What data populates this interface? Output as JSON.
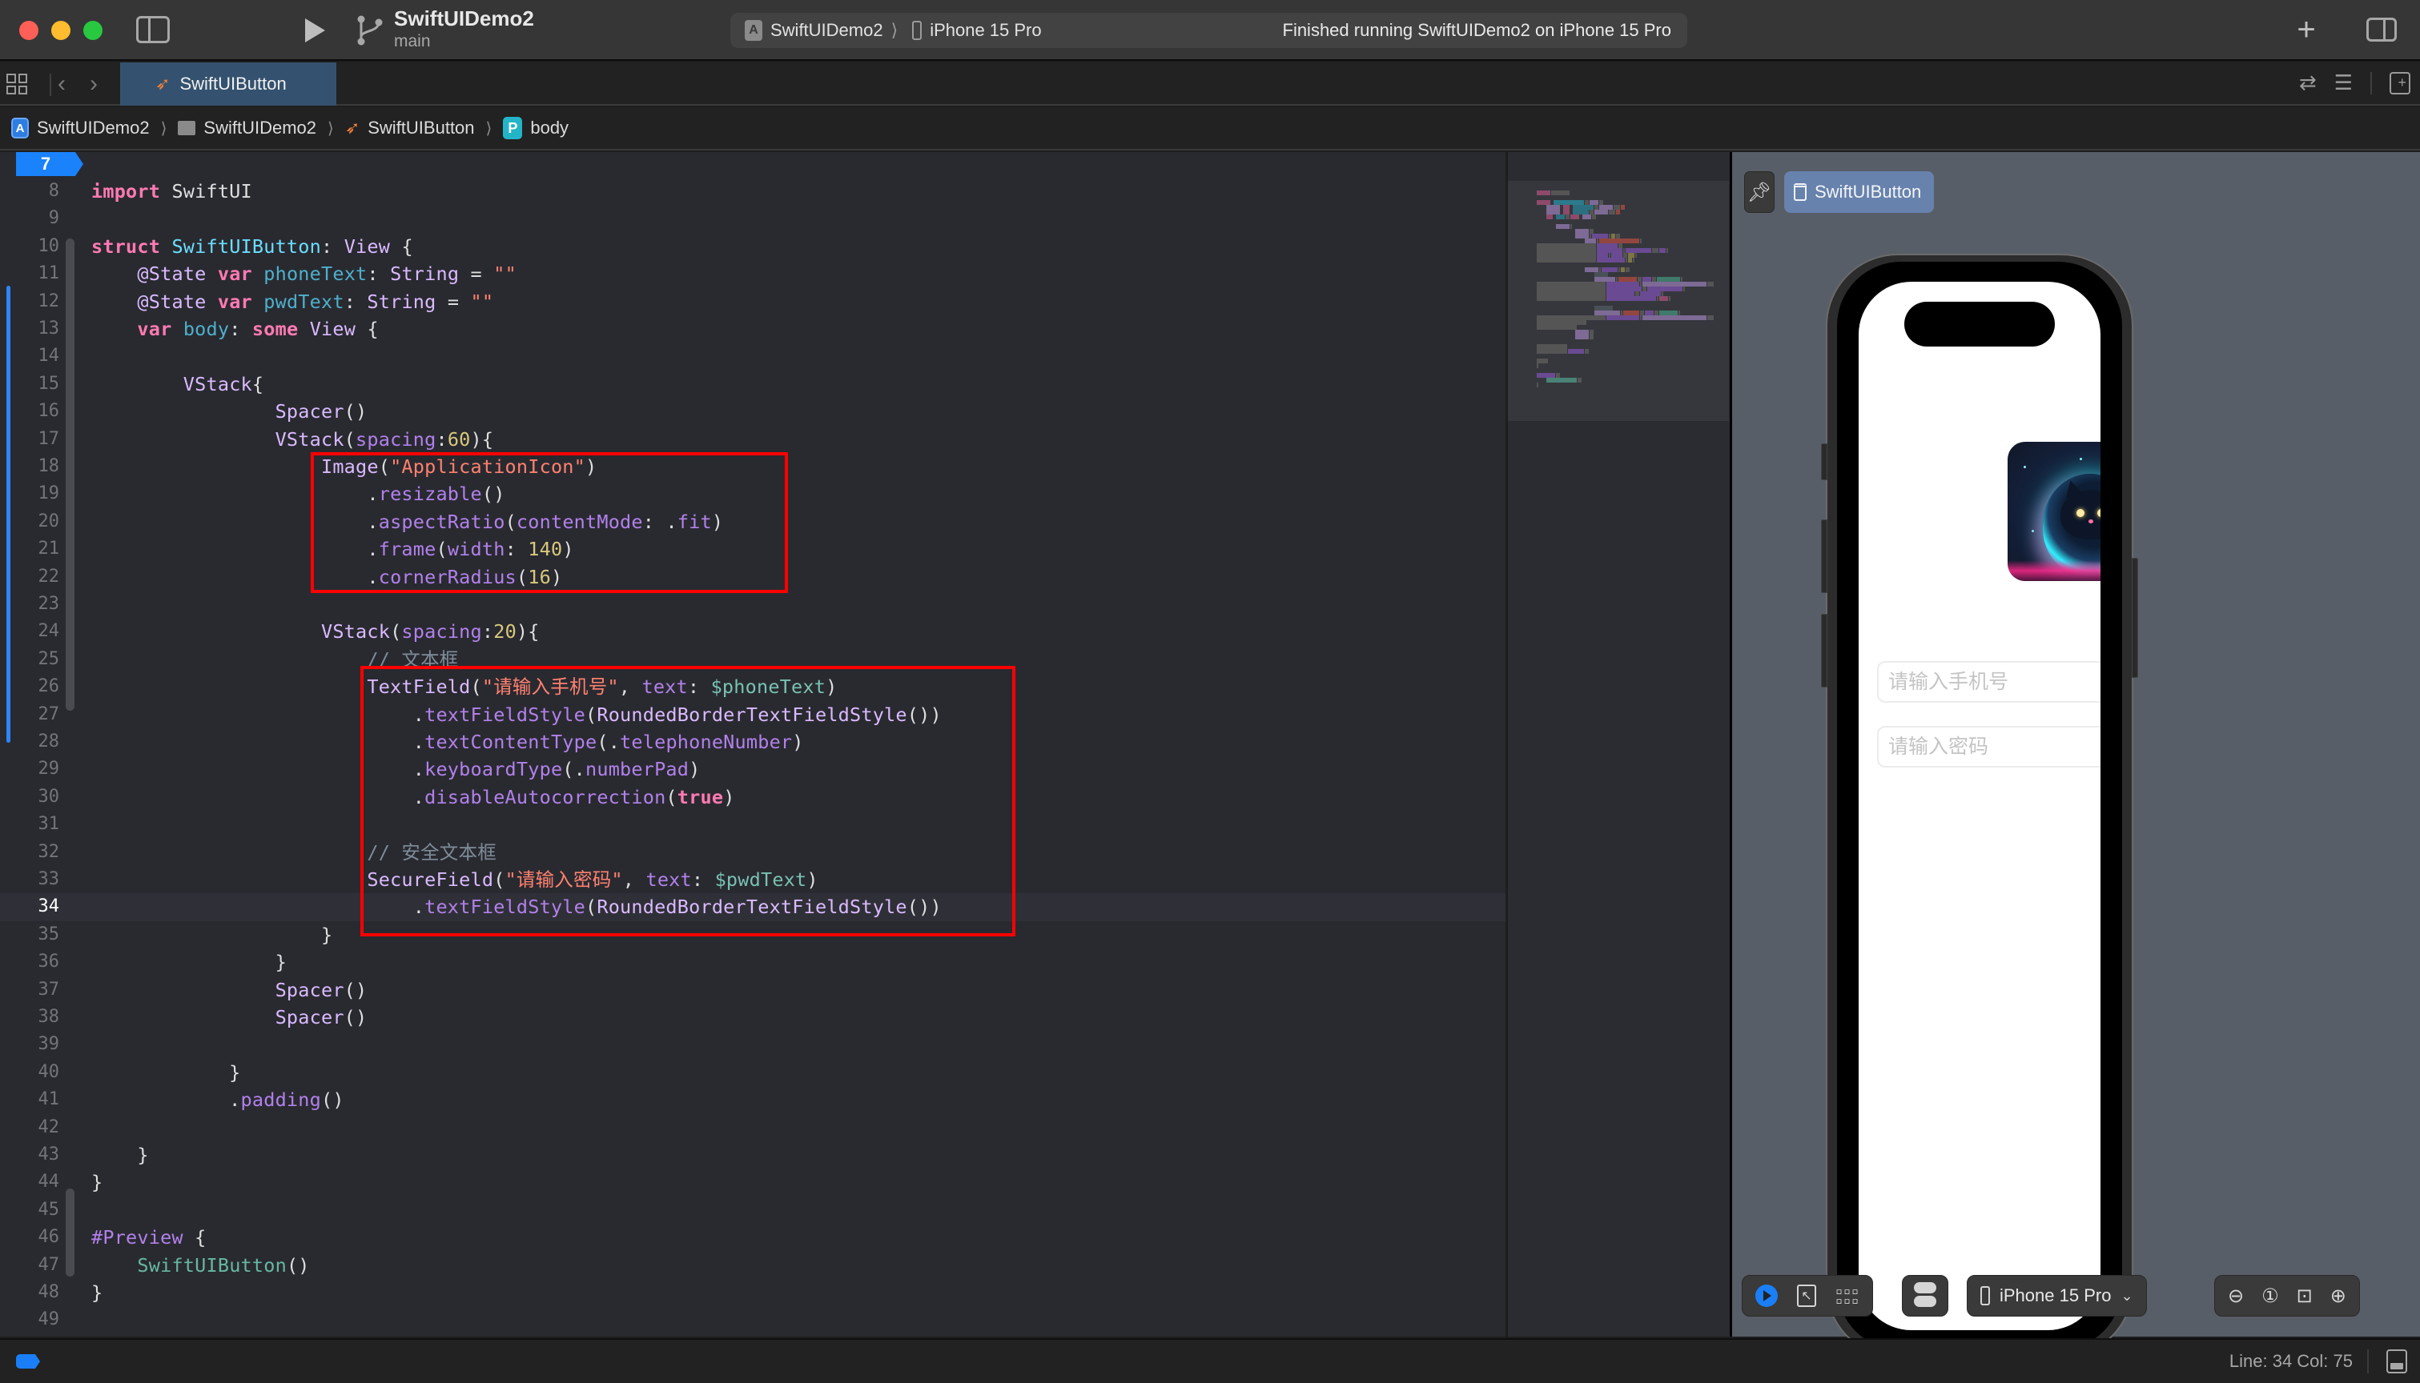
{
  "window": {
    "project_name": "SwiftUIDemo2",
    "branch": "main",
    "activity": {
      "scheme": "SwiftUIDemo2",
      "destination": "iPhone 15 Pro",
      "status": "Finished running SwiftUIDemo2 on iPhone 15 Pro"
    },
    "icons": {
      "close": "close-window",
      "minimize": "minimize-window",
      "zoom": "zoom-window",
      "navigator": "sidebar-left-icon",
      "run": "play-icon",
      "branch": "branch-icon",
      "add": "plus-icon",
      "inspector": "sidebar-right-icon"
    }
  },
  "tabs": [
    {
      "label": "SwiftUIButton",
      "icon": "swift-icon",
      "active": true
    }
  ],
  "tab_bar_right": [
    "swap-icon",
    "minimap-toggle-icon",
    "add-editor-icon"
  ],
  "breadcrumb": [
    {
      "label": "SwiftUIDemo2",
      "icon": "app-project-icon"
    },
    {
      "label": "SwiftUIDemo2",
      "icon": "folder-icon"
    },
    {
      "label": "SwiftUIButton",
      "icon": "swift-icon"
    },
    {
      "label": "body",
      "icon": "property-icon",
      "icon_letter": "P"
    }
  ],
  "editor": {
    "first_line_marker": "7",
    "current_line": 34,
    "lines": [
      {
        "n": "8",
        "tokens": [
          [
            "kw",
            "import"
          ],
          [
            "pl",
            " SwiftUI"
          ]
        ]
      },
      {
        "n": "9",
        "tokens": []
      },
      {
        "n": "10",
        "tokens": [
          [
            "kw",
            "struct"
          ],
          [
            "pl",
            " "
          ],
          [
            "pr",
            "SwiftUIButton"
          ],
          [
            "pl",
            ": "
          ],
          [
            "ty",
            "View"
          ],
          [
            "pl",
            " {"
          ]
        ]
      },
      {
        "n": "11",
        "tokens": [
          [
            "pl",
            "    "
          ],
          [
            "ty",
            "@State"
          ],
          [
            "pl",
            " "
          ],
          [
            "kw",
            "var"
          ],
          [
            "pl",
            " "
          ],
          [
            "pr2",
            "phoneText"
          ],
          [
            "pl",
            ": "
          ],
          [
            "ty",
            "String"
          ],
          [
            "pl",
            " = "
          ],
          [
            "st",
            "\"\""
          ]
        ]
      },
      {
        "n": "12",
        "tokens": [
          [
            "pl",
            "    "
          ],
          [
            "ty",
            "@State"
          ],
          [
            "pl",
            " "
          ],
          [
            "kw",
            "var"
          ],
          [
            "pl",
            " "
          ],
          [
            "pr2",
            "pwdText"
          ],
          [
            "pl",
            ": "
          ],
          [
            "ty",
            "String"
          ],
          [
            "pl",
            " = "
          ],
          [
            "st",
            "\"\""
          ]
        ]
      },
      {
        "n": "13",
        "tokens": [
          [
            "pl",
            "    "
          ],
          [
            "kw",
            "var"
          ],
          [
            "pl",
            " "
          ],
          [
            "pr2",
            "body"
          ],
          [
            "pl",
            ": "
          ],
          [
            "kw",
            "some"
          ],
          [
            "pl",
            " "
          ],
          [
            "ty",
            "View"
          ],
          [
            "pl",
            " {"
          ]
        ]
      },
      {
        "n": "14",
        "tokens": []
      },
      {
        "n": "15",
        "tokens": [
          [
            "pl",
            "        "
          ],
          [
            "ty",
            "VStack"
          ],
          [
            "pl",
            "{"
          ]
        ]
      },
      {
        "n": "16",
        "tokens": [
          [
            "pl",
            "                "
          ],
          [
            "ty",
            "Spacer"
          ],
          [
            "pl",
            "()"
          ]
        ]
      },
      {
        "n": "17",
        "tokens": [
          [
            "pl",
            "                "
          ],
          [
            "ty",
            "VStack"
          ],
          [
            "pl",
            "("
          ],
          [
            "fn",
            "spacing"
          ],
          [
            "pl",
            ":"
          ],
          [
            "nm",
            "60"
          ],
          [
            "pl",
            "){"
          ]
        ]
      },
      {
        "n": "18",
        "tokens": [
          [
            "pl",
            "                    "
          ],
          [
            "ty",
            "Image"
          ],
          [
            "pl",
            "("
          ],
          [
            "st",
            "\"ApplicationIcon\""
          ],
          [
            "pl",
            ")"
          ]
        ]
      },
      {
        "n": "19",
        "tokens": [
          [
            "pl",
            "                        ."
          ],
          [
            "fn",
            "resizable"
          ],
          [
            "pl",
            "()"
          ]
        ]
      },
      {
        "n": "20",
        "tokens": [
          [
            "pl",
            "                        ."
          ],
          [
            "fn",
            "aspectRatio"
          ],
          [
            "pl",
            "("
          ],
          [
            "fn",
            "contentMode"
          ],
          [
            "pl",
            ": ."
          ],
          [
            "fn",
            "fit"
          ],
          [
            "pl",
            ")"
          ]
        ]
      },
      {
        "n": "21",
        "tokens": [
          [
            "pl",
            "                        ."
          ],
          [
            "fn",
            "frame"
          ],
          [
            "pl",
            "("
          ],
          [
            "fn",
            "width"
          ],
          [
            "pl",
            ": "
          ],
          [
            "nm",
            "140"
          ],
          [
            "pl",
            ")"
          ]
        ]
      },
      {
        "n": "22",
        "tokens": [
          [
            "pl",
            "                        ."
          ],
          [
            "fn",
            "cornerRadius"
          ],
          [
            "pl",
            "("
          ],
          [
            "nm",
            "16"
          ],
          [
            "pl",
            ")"
          ]
        ]
      },
      {
        "n": "23",
        "tokens": []
      },
      {
        "n": "24",
        "tokens": [
          [
            "pl",
            "                    "
          ],
          [
            "ty",
            "VStack"
          ],
          [
            "pl",
            "("
          ],
          [
            "fn",
            "spacing"
          ],
          [
            "pl",
            ":"
          ],
          [
            "nm",
            "20"
          ],
          [
            "pl",
            "){"
          ]
        ]
      },
      {
        "n": "25",
        "tokens": [
          [
            "pl",
            "                        "
          ],
          [
            "cm",
            "// 文本框"
          ]
        ]
      },
      {
        "n": "26",
        "tokens": [
          [
            "pl",
            "                        "
          ],
          [
            "ty",
            "TextField"
          ],
          [
            "pl",
            "("
          ],
          [
            "st",
            "\"请输入手机号\""
          ],
          [
            "pl",
            ", "
          ],
          [
            "fn",
            "text"
          ],
          [
            "pl",
            ": "
          ],
          [
            "tx",
            "$phoneText"
          ],
          [
            "pl",
            ")"
          ]
        ]
      },
      {
        "n": "27",
        "tokens": [
          [
            "pl",
            "                            ."
          ],
          [
            "fn",
            "textFieldStyle"
          ],
          [
            "pl",
            "("
          ],
          [
            "ty",
            "RoundedBorderTextFieldStyle"
          ],
          [
            "pl",
            "())"
          ]
        ]
      },
      {
        "n": "28",
        "tokens": [
          [
            "pl",
            "                            ."
          ],
          [
            "fn",
            "textContentType"
          ],
          [
            "pl",
            "(."
          ],
          [
            "fn",
            "telephoneNumber"
          ],
          [
            "pl",
            ")"
          ]
        ]
      },
      {
        "n": "29",
        "tokens": [
          [
            "pl",
            "                            ."
          ],
          [
            "fn",
            "keyboardType"
          ],
          [
            "pl",
            "(."
          ],
          [
            "fn",
            "numberPad"
          ],
          [
            "pl",
            ")"
          ]
        ]
      },
      {
        "n": "30",
        "tokens": [
          [
            "pl",
            "                            ."
          ],
          [
            "fn",
            "disableAutocorrection"
          ],
          [
            "pl",
            "("
          ],
          [
            "kw",
            "true"
          ],
          [
            "pl",
            ")"
          ]
        ]
      },
      {
        "n": "31",
        "tokens": []
      },
      {
        "n": "32",
        "tokens": [
          [
            "pl",
            "                        "
          ],
          [
            "cm",
            "// 安全文本框"
          ]
        ]
      },
      {
        "n": "33",
        "tokens": [
          [
            "pl",
            "                        "
          ],
          [
            "ty",
            "SecureField"
          ],
          [
            "pl",
            "("
          ],
          [
            "st",
            "\"请输入密码\""
          ],
          [
            "pl",
            ", "
          ],
          [
            "fn",
            "text"
          ],
          [
            "pl",
            ": "
          ],
          [
            "tx",
            "$pwdText"
          ],
          [
            "pl",
            ")"
          ]
        ]
      },
      {
        "n": "34",
        "tokens": [
          [
            "pl",
            "                            ."
          ],
          [
            "fn",
            "textFieldStyle"
          ],
          [
            "pl",
            "("
          ],
          [
            "ty",
            "RoundedBorderTextFieldStyle"
          ],
          [
            "pl",
            "())"
          ]
        ]
      },
      {
        "n": "35",
        "tokens": [
          [
            "pl",
            "                    }"
          ]
        ]
      },
      {
        "n": "36",
        "tokens": [
          [
            "pl",
            "                }"
          ]
        ]
      },
      {
        "n": "37",
        "tokens": [
          [
            "pl",
            "                "
          ],
          [
            "ty",
            "Spacer"
          ],
          [
            "pl",
            "()"
          ]
        ]
      },
      {
        "n": "38",
        "tokens": [
          [
            "pl",
            "                "
          ],
          [
            "ty",
            "Spacer"
          ],
          [
            "pl",
            "()"
          ]
        ]
      },
      {
        "n": "39",
        "tokens": []
      },
      {
        "n": "40",
        "tokens": [
          [
            "pl",
            "            }"
          ]
        ]
      },
      {
        "n": "41",
        "tokens": [
          [
            "pl",
            "            ."
          ],
          [
            "fn",
            "padding"
          ],
          [
            "pl",
            "()"
          ]
        ]
      },
      {
        "n": "42",
        "tokens": []
      },
      {
        "n": "43",
        "tokens": [
          [
            "pl",
            "    }"
          ]
        ]
      },
      {
        "n": "44",
        "tokens": [
          [
            "pl",
            "}"
          ]
        ]
      },
      {
        "n": "45",
        "tokens": []
      },
      {
        "n": "46",
        "tokens": [
          [
            "pv",
            "#Preview"
          ],
          [
            "pl",
            " {"
          ]
        ]
      },
      {
        "n": "47",
        "tokens": [
          [
            "pl",
            "    "
          ],
          [
            "bd",
            "SwiftUIButton"
          ],
          [
            "pl",
            "()"
          ]
        ]
      },
      {
        "n": "48",
        "tokens": [
          [
            "pl",
            "}"
          ]
        ]
      },
      {
        "n": "49",
        "tokens": []
      }
    ],
    "annotations": [
      {
        "label": "image-block-highlight",
        "from_line": 18,
        "to_line": 22
      },
      {
        "label": "fields-block-highlight",
        "from_line": 26,
        "to_line": 34
      }
    ],
    "colors": {
      "keyword": "#ff7ab2",
      "type": "#dabaff",
      "method": "#b281eb",
      "string": "#ff8170",
      "number": "#d9c97c",
      "comment": "#7f8c98",
      "annotation_box": "#ff0000"
    }
  },
  "preview": {
    "pin_icon": "pin-icon",
    "chip_label": "SwiftUIButton",
    "chip_icon": "preview-canvas-icon",
    "app_image": "ApplicationIcon",
    "phone_placeholder": "请输入手机号",
    "password_placeholder": "请输入密码",
    "toolbar": {
      "live_icon": "play-circle-icon",
      "select_icon": "selectable-cursor-icon",
      "variants_icon": "variants-grid-icon",
      "settings_icon": "device-settings-icon",
      "device_label": "iPhone 15 Pro",
      "zoom_icons": [
        "zoom-out-icon",
        "zoom-actual-icon",
        "zoom-fit-icon",
        "zoom-in-icon"
      ]
    }
  },
  "status_bar": {
    "cursor": "Line: 34  Col: 75"
  }
}
